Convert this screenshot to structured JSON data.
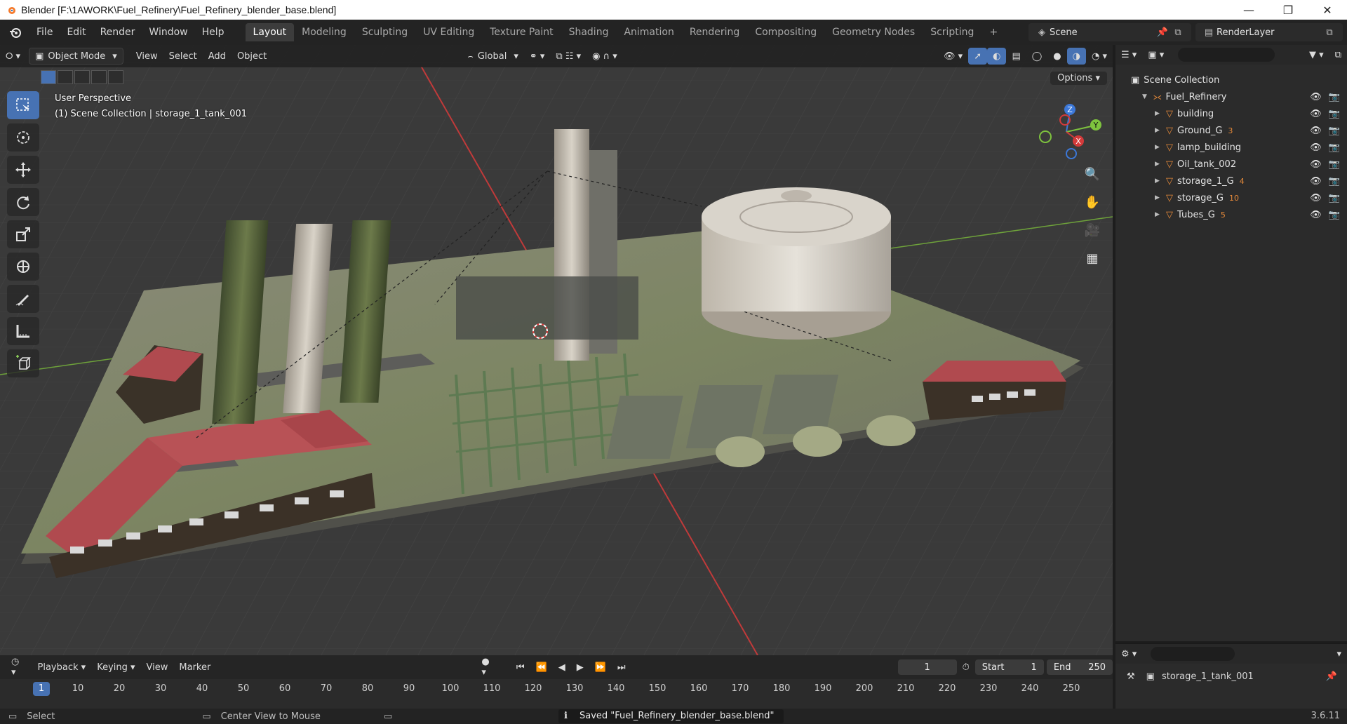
{
  "window": {
    "title": "Blender [F:\\1AWORK\\Fuel_Refinery\\Fuel_Refinery_blender_base.blend]",
    "controls": [
      "minimize-icon",
      "restore-icon",
      "close-icon"
    ]
  },
  "menu": {
    "items": [
      "File",
      "Edit",
      "Render",
      "Window",
      "Help"
    ],
    "workspaces": [
      "Layout",
      "Modeling",
      "Sculpting",
      "UV Editing",
      "Texture Paint",
      "Shading",
      "Animation",
      "Rendering",
      "Compositing",
      "Geometry Nodes",
      "Scripting",
      "+"
    ],
    "active_workspace": "Layout",
    "scene": "Scene",
    "view_layer": "RenderLayer"
  },
  "viewport": {
    "mode": "Object Mode",
    "menus": [
      "View",
      "Select",
      "Add",
      "Object"
    ],
    "transform_orientation": "Global",
    "perspective_label": "User Perspective",
    "collection_label": "(1) Scene Collection | storage_1_tank_001",
    "options_label": "Options",
    "gizmo_axes": [
      "X",
      "Y",
      "Z"
    ]
  },
  "toolbar": {
    "tools": [
      "select-box-icon",
      "cursor-icon",
      "move-icon",
      "rotate-icon",
      "scale-icon",
      "transform-icon",
      "annotate-icon",
      "measure-icon",
      "add-cube-icon"
    ]
  },
  "outliner": {
    "root": "Scene Collection",
    "collection": "Fuel_Refinery",
    "items": [
      {
        "name": "building",
        "badge": ""
      },
      {
        "name": "Ground_G",
        "badge": "3"
      },
      {
        "name": "lamp_building",
        "badge": ""
      },
      {
        "name": "Oil_tank_002",
        "badge": ""
      },
      {
        "name": "storage_1_G",
        "badge": "4"
      },
      {
        "name": "storage_G",
        "badge": "10"
      },
      {
        "name": "Tubes_G",
        "badge": "5"
      }
    ]
  },
  "properties": {
    "active_object": "storage_1_tank_001"
  },
  "timeline": {
    "menus": [
      "Playback",
      "Keying",
      "View",
      "Marker"
    ],
    "current_frame": "1",
    "start_label": "Start",
    "start": "1",
    "end_label": "End",
    "end": "250",
    "ruler_ticks": [
      "10",
      "20",
      "30",
      "40",
      "50",
      "60",
      "70",
      "80",
      "90",
      "100",
      "110",
      "120",
      "130",
      "140",
      "150",
      "160",
      "170",
      "180",
      "190",
      "200",
      "210",
      "220",
      "230",
      "240",
      "250"
    ],
    "ruler_current": "1"
  },
  "status": {
    "left_hint": "Select",
    "mid_hint": "Center View to Mouse",
    "message": "Saved \"Fuel_Refinery_blender_base.blend\"",
    "version": "3.6.11"
  },
  "colors": {
    "accent": "#4772b3",
    "x_axis": "#d33a3a",
    "y_axis": "#7ec33e",
    "z_axis": "#3c78d8",
    "roof_red": "#b04a4f"
  }
}
